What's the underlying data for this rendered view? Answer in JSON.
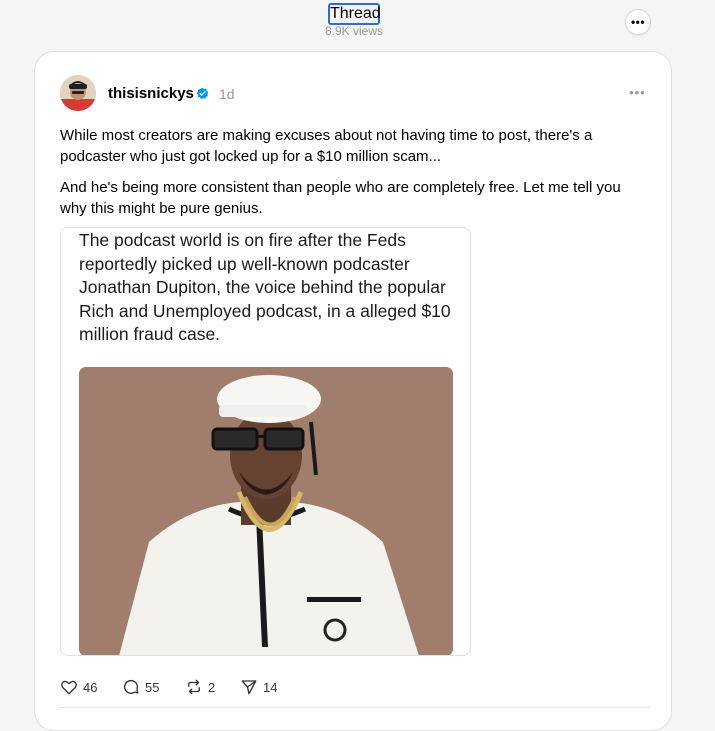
{
  "header": {
    "title": "Thread",
    "views": "8.9K views"
  },
  "post": {
    "username": "thisisnickys",
    "time_ago": "1d",
    "paragraphs": [
      "While most creators are making excuses about not having time to post, there's a podcaster who just got locked up for a $10 million scam...",
      "And he's being more consistent than people who are completely free. Let me tell you why this might be pure genius."
    ],
    "media_caption": "The podcast world is on fire after the Feds reportedly picked up well-known podcaster Jonathan Dupiton, the voice behind the popular Rich and Unemployed podcast, in a alleged $10 million fraud case.",
    "actions": {
      "likes": "46",
      "replies": "55",
      "reposts": "2",
      "shares": "14"
    }
  },
  "icons": {
    "more": "more-horizontal-icon",
    "verified": "verified-badge-icon",
    "like": "heart-icon",
    "reply": "comment-icon",
    "repost": "repost-icon",
    "share": "send-icon"
  },
  "colors": {
    "focus_outline": "#2e6bd6",
    "verified_blue": "#0095f6",
    "muted_text": "#999999",
    "photo_background": "#a78373"
  }
}
